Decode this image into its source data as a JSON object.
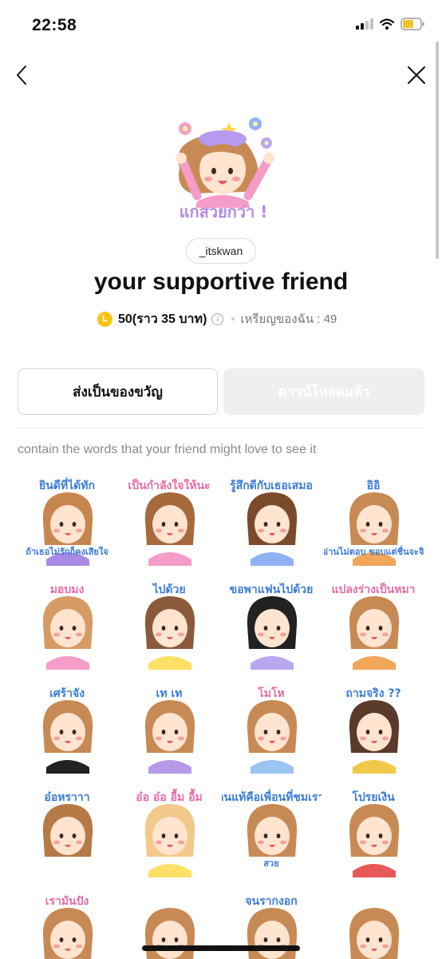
{
  "status_bar": {
    "time": "22:58"
  },
  "nav": {
    "back_icon": "chevron-left-icon",
    "close_icon": "close-icon"
  },
  "hero": {
    "caption": "แกสวยกว่า !"
  },
  "product": {
    "author": "_itskwan",
    "title": "your supportive friend",
    "coin_symbol": "L",
    "price": "50(ราว 35 บาท)",
    "info_symbol": "i",
    "my_coins": "เหรียญของฉัน : 49"
  },
  "actions": {
    "gift_label": "ส่งเป็นของขวัญ",
    "download_label": "ดาวน์โหลดแล้ว"
  },
  "description": "contain the words that your friend might love to see it",
  "stickers": [
    {
      "text": "ยินดีที่ได้ทัก",
      "text2": "ถ้าเธอไม่รักก็คงเสียใจ"
    },
    {
      "text": "เป็นกำลังใจให้นะ"
    },
    {
      "text": "รู้สึกดีกับเธอเสมอ"
    },
    {
      "text": "อิอิ",
      "text2": "อ่านไม่ตอบ ขอบแต่ชื่นจะจิ"
    },
    {
      "text": "มอบมง"
    },
    {
      "text": "ไปด้วย"
    },
    {
      "text": "ขอพาแฟนไปด้วย"
    },
    {
      "text": "แปลงร่างเป็นหมา"
    },
    {
      "text": "เศร้าจัง"
    },
    {
      "text": "เท เท"
    },
    {
      "text": "โมโห"
    },
    {
      "text": "ถามจริง ??"
    },
    {
      "text": "อ๋อหราาา"
    },
    {
      "text": "อ๋อ อ๋อ อื้ม อื้ม"
    },
    {
      "text": "เพื่อนแท้คือเพื่อนที่ชมเราว่า",
      "text2": "สวย"
    },
    {
      "text": "โปรยเงิน"
    },
    {
      "text": "เรามันปัง"
    },
    {
      "text": ""
    },
    {
      "text": "จนรากงอก"
    },
    {
      "text": ""
    }
  ],
  "colors": {
    "accent_coin": "#f5c518",
    "sticker_text": "#3a7bd5",
    "sticker_pink": "#e86aa6"
  }
}
